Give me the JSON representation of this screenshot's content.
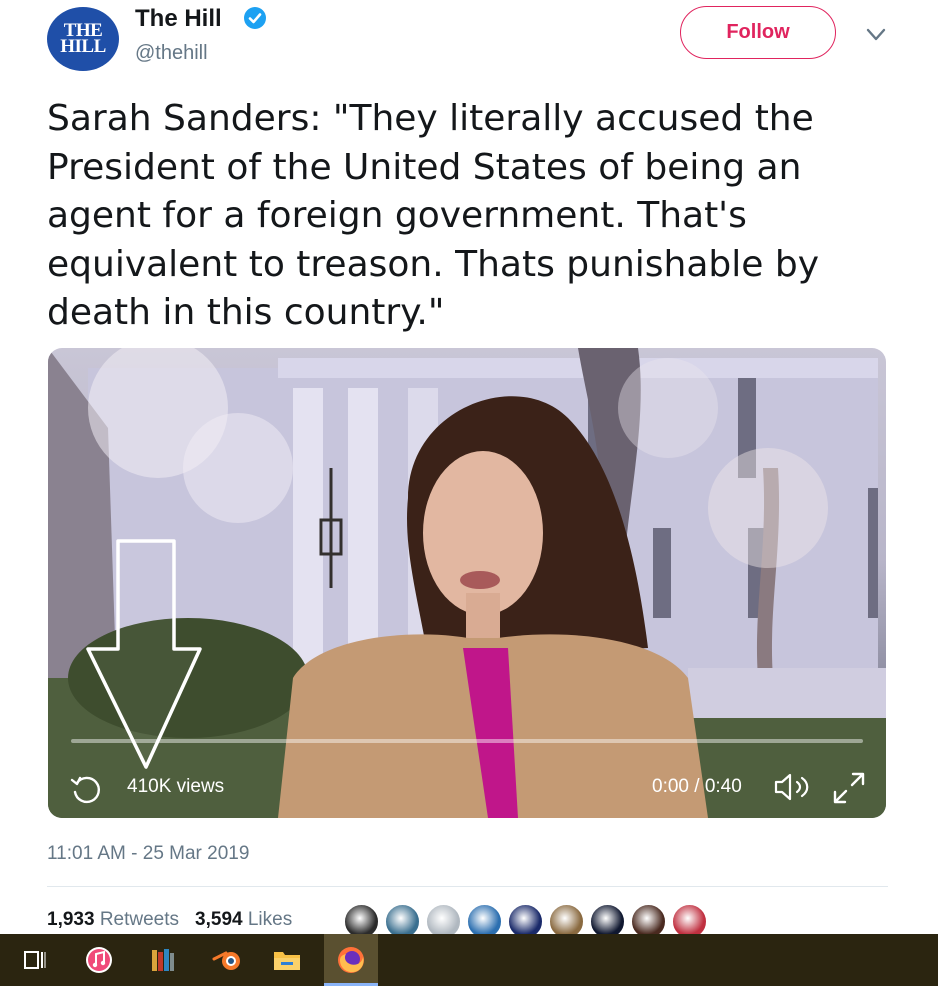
{
  "account": {
    "avatar_text_line1": "THE",
    "avatar_text_line2": "HILL",
    "name": "The Hill",
    "handle": "@thehill",
    "verified": true
  },
  "follow_button_label": "Follow",
  "menu_icon": "chevron-down-icon",
  "tweet_text": "Sarah Sanders: \"They literally accused the President of the United States of being an agent for a foreign government. That's equivalent to treason. Thats punishable by death in this country.\"",
  "video": {
    "views": "410K views",
    "timecode": "0:00 / 0:40",
    "progress": 0.0,
    "icons": [
      "replay-icon",
      "volume-icon",
      "expand-icon"
    ]
  },
  "timestamp": "11:01 AM - 25 Mar 2019",
  "stats": {
    "retweets_count": "1,933",
    "retweets_label": "Retweets",
    "likes_count": "3,594",
    "likes_label": "Likes"
  },
  "likers": [
    {
      "color": "#2b2b2b"
    },
    {
      "color": "#3a6f8f"
    },
    {
      "color": "#b0b8c0"
    },
    {
      "color": "#2c6fb0"
    },
    {
      "color": "#1a2a6a"
    },
    {
      "color": "#8a6a40"
    },
    {
      "color": "#101830"
    },
    {
      "color": "#4a2a20"
    },
    {
      "color": "#c03040"
    }
  ],
  "taskbar": {
    "icons": [
      "task-view-icon",
      "itunes-icon",
      "library-icon",
      "blender-icon",
      "file-explorer-icon",
      "firefox-icon"
    ],
    "active": "firefox-icon"
  },
  "colors": {
    "accent_red": "#e0245e",
    "verified_blue": "#1da1f2",
    "muted": "#657786",
    "taskbar": "#2b2510"
  }
}
